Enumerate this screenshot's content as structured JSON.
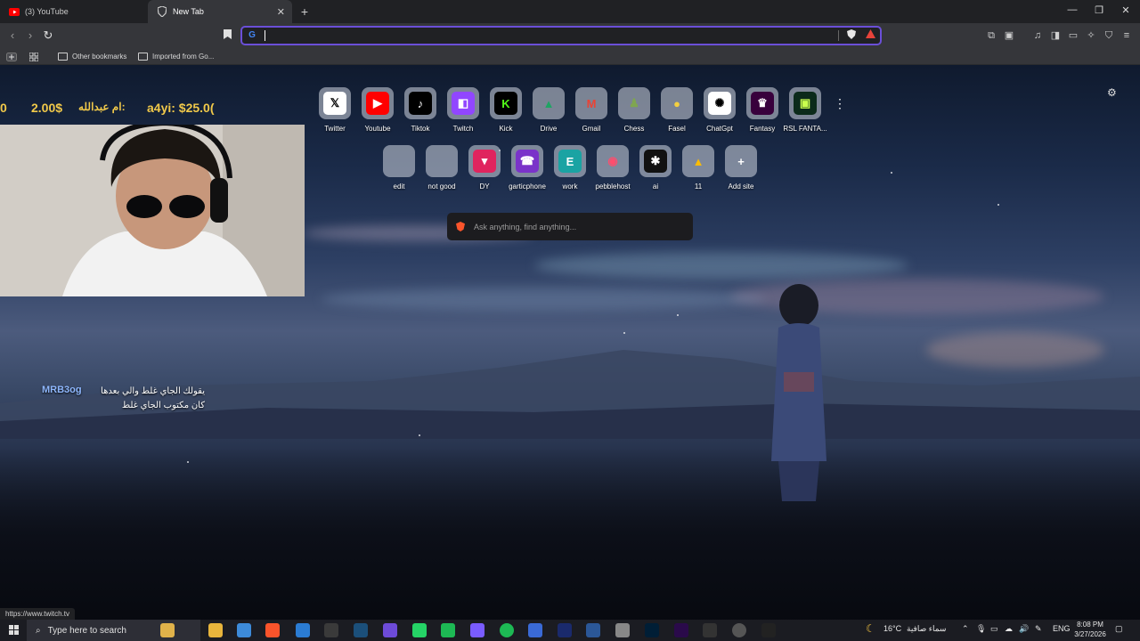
{
  "tabs": [
    {
      "title": "(3) YouTube",
      "icon": "youtube-icon"
    },
    {
      "title": "New Tab",
      "icon": "brave-shield-icon",
      "active": true
    }
  ],
  "window_controls": {
    "minimize": "—",
    "restore": "❐",
    "close": "✕"
  },
  "toolbar": {
    "omnibox_value": "",
    "search_engine_badge": "G",
    "back": "‹",
    "forward": "›",
    "reload": "↻"
  },
  "bookmarks": {
    "items": [
      {
        "label": "Other bookmarks"
      },
      {
        "label": "Imported from Go..."
      }
    ]
  },
  "stream_overlay": {
    "donation_1": "2.00$",
    "donation_1_name": "ام عبدالله:",
    "donation_2": "a4yi: $25.0(",
    "donation_0": "0",
    "chat_user": "MRB3og",
    "chat_message": "يقولك الجاي غلط والي بعدها كان مكتوب الجاي غلط"
  },
  "shortcuts_row1": [
    {
      "label": "Twitter",
      "glyph": "𝕏",
      "bg": "#ffffff",
      "fg": "#000000"
    },
    {
      "label": "Youtube",
      "glyph": "▶",
      "bg": "#ff0000",
      "fg": "#ffffff"
    },
    {
      "label": "Tiktok",
      "glyph": "♪",
      "bg": "#000000",
      "fg": "#ffffff"
    },
    {
      "label": "Twitch",
      "glyph": "◧",
      "bg": "#9146ff",
      "fg": "#ffffff"
    },
    {
      "label": "Kick",
      "glyph": "K",
      "bg": "#000000",
      "fg": "#53fc18"
    },
    {
      "label": "Drive",
      "glyph": "▲",
      "bg": "transparent",
      "fg": "#1fa463"
    },
    {
      "label": "Gmail",
      "glyph": "M",
      "bg": "transparent",
      "fg": "#ea4335"
    },
    {
      "label": "Chess",
      "glyph": "♟",
      "bg": "transparent",
      "fg": "#7fa650"
    },
    {
      "label": "Fasel",
      "glyph": "●",
      "bg": "transparent",
      "fg": "#f4d03f"
    },
    {
      "label": "ChatGpt",
      "glyph": "✺",
      "bg": "#ffffff",
      "fg": "#000000"
    },
    {
      "label": "Fantasy",
      "glyph": "♛",
      "bg": "#38003c",
      "fg": "#ffffff"
    },
    {
      "label": "RSL FANTA...",
      "glyph": "▣",
      "bg": "#0b2a1a",
      "fg": "#c9ff4d"
    }
  ],
  "shortcuts_row2": [
    {
      "label": "edit",
      "glyph": "",
      "bg": "transparent",
      "fg": "#ffffff"
    },
    {
      "label": "not good",
      "glyph": "",
      "bg": "transparent",
      "fg": "#ffffff"
    },
    {
      "label": "DY",
      "glyph": "▾",
      "bg": "#e0245e",
      "fg": "#ffffff"
    },
    {
      "label": "garticphone",
      "glyph": "☎",
      "bg": "#7a33c9",
      "fg": "#ffffff"
    },
    {
      "label": "work",
      "glyph": "E",
      "bg": "#1aa3a3",
      "fg": "#ffffff"
    },
    {
      "label": "pebblehost",
      "glyph": "◉",
      "bg": "transparent",
      "fg": "#ff4d6d"
    },
    {
      "label": "ai",
      "glyph": "✱",
      "bg": "#111111",
      "fg": "#ffffff"
    },
    {
      "label": "11",
      "glyph": "▲",
      "bg": "transparent",
      "fg": "#fbbc04"
    },
    {
      "label": "Add site",
      "glyph": "+",
      "bg": "transparent",
      "fg": "#ffffff"
    }
  ],
  "ask_placeholder": "Ask anything, find anything...",
  "status_url": "https://www.twitch.tv",
  "taskbar": {
    "search_placeholder": "Type here to search",
    "weather_temp": "16°C",
    "weather_desc": "سماء صافية",
    "language": "ENG",
    "time": "8:08 PM",
    "date": "3/27/2026"
  }
}
